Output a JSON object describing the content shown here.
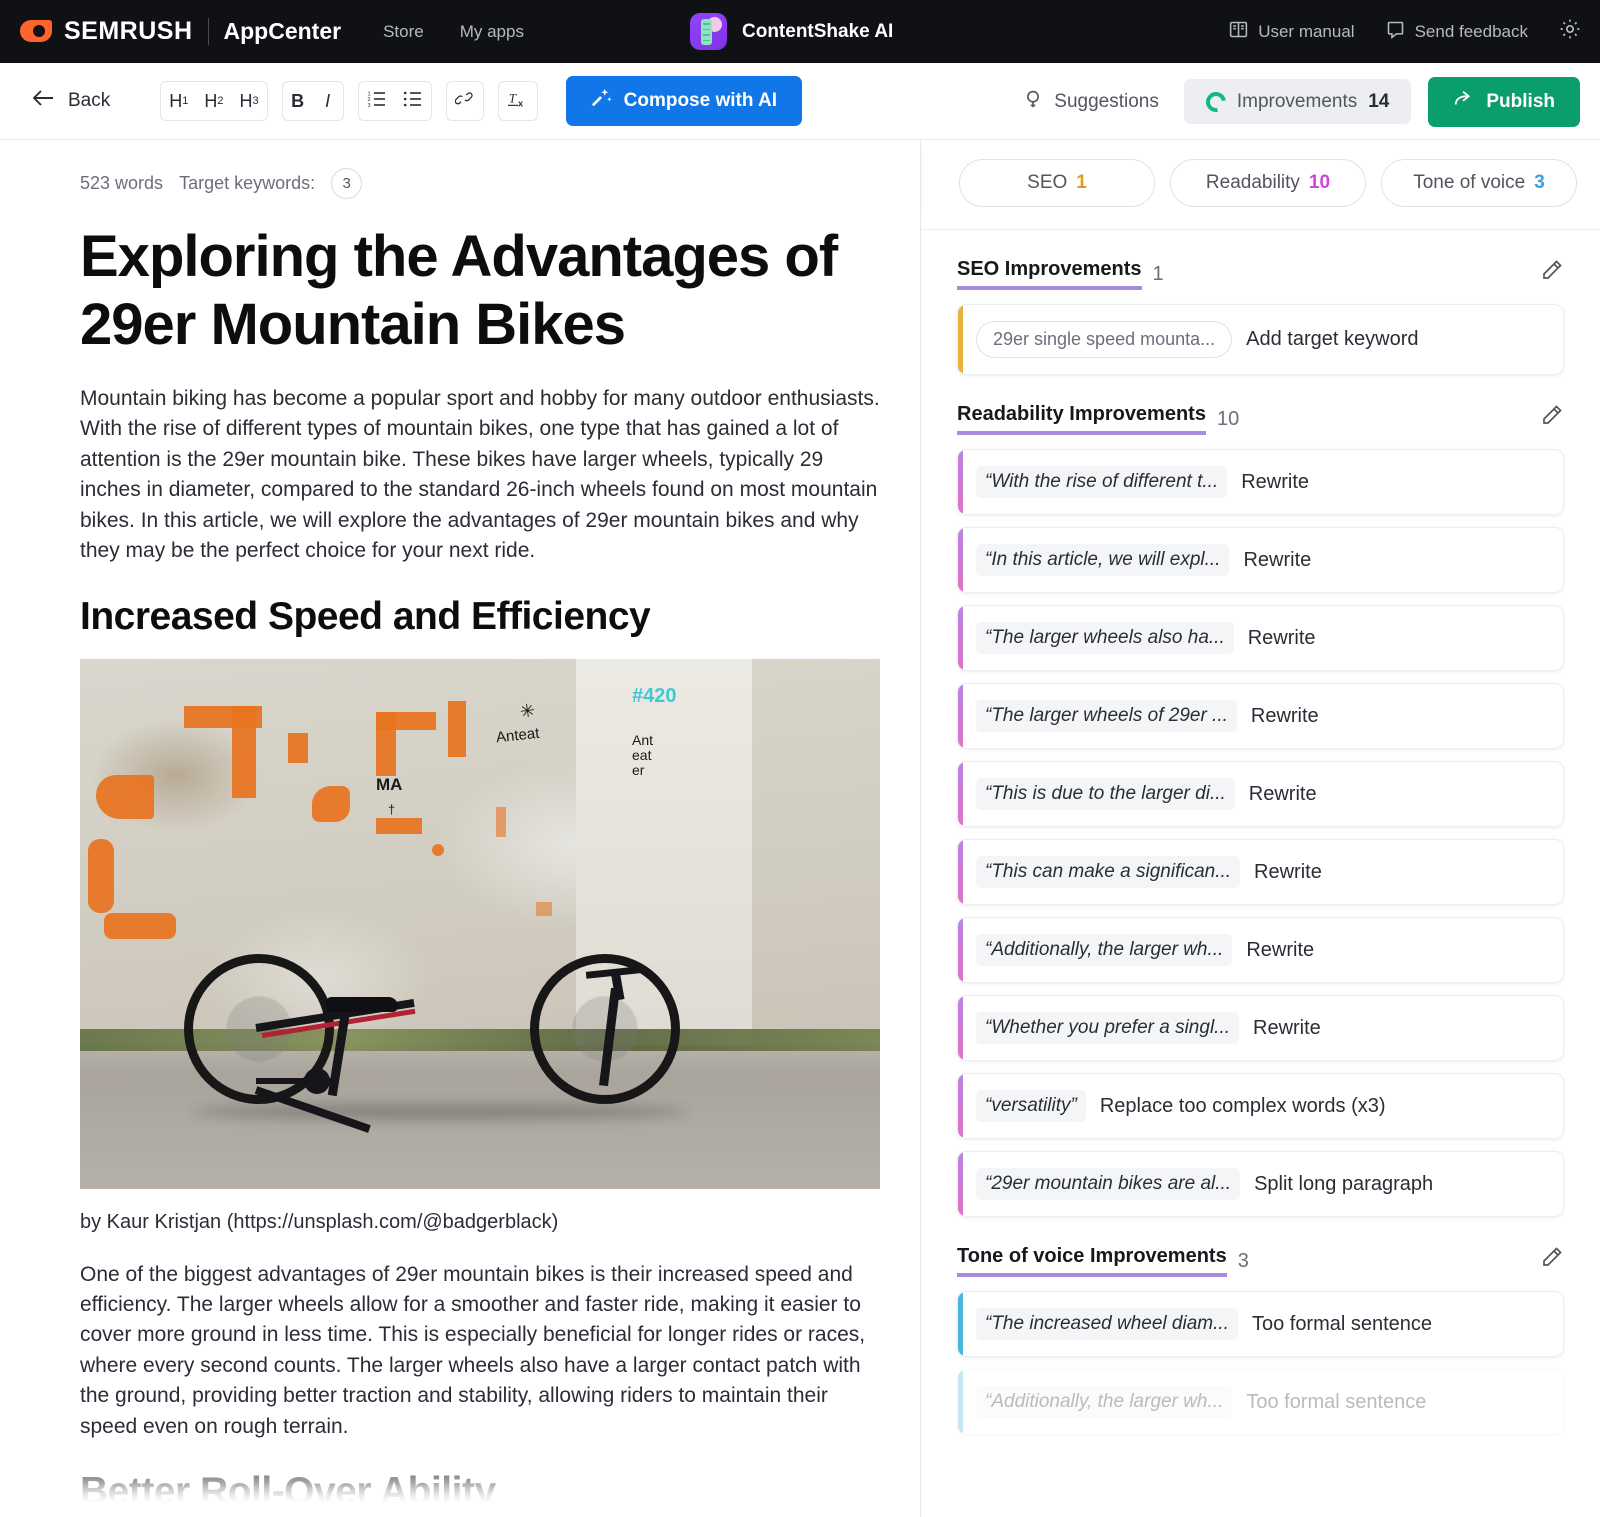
{
  "topbar": {
    "brand": "SEMRUSH",
    "brand_sub": "AppCenter",
    "nav": [
      {
        "label": "Store"
      },
      {
        "label": "My apps"
      }
    ],
    "app_title": "ContentShake AI",
    "right_items": [
      {
        "label": "User manual",
        "icon": "book-icon"
      },
      {
        "label": "Send feedback",
        "icon": "speech-bubble-icon"
      }
    ],
    "settings_icon": "gear-icon"
  },
  "toolbar": {
    "back_label": "Back",
    "format_groups": [
      {
        "buttons": [
          {
            "label": "H1"
          },
          {
            "label": "H2"
          },
          {
            "label": "H3"
          }
        ]
      },
      {
        "buttons": [
          {
            "label": "B"
          },
          {
            "label": "I"
          }
        ]
      },
      {
        "buttons": [
          {
            "label": "ordered-list-icon"
          },
          {
            "label": "bulleted-list-icon"
          }
        ]
      },
      {
        "buttons": [
          {
            "label": "link-icon"
          }
        ]
      },
      {
        "buttons": [
          {
            "label": "clear-formatting-icon"
          }
        ]
      }
    ],
    "compose_label": "Compose with AI",
    "suggestions_label": "Suggestions",
    "improvements_label": "Improvements",
    "improvements_count": "14",
    "publish_label": "Publish"
  },
  "editor": {
    "word_count": "523 words",
    "target_keywords_label": "Target keywords:",
    "target_keywords_count": "3",
    "title": "Exploring the Advantages of 29er Mountain Bikes",
    "paragraph_1": "Mountain biking has become a popular sport and hobby for many outdoor enthusiasts. With the rise of different types of mountain bikes, one type that has gained a lot of attention is the 29er mountain bike. These bikes have larger wheels, typically 29 inches in diameter, compared to the standard 26-inch wheels found on most mountain bikes. In this article, we will explore the advantages of 29er mountain bikes and why they may be the perfect choice for your next ride.",
    "heading_2": "Increased Speed and Efficiency",
    "image_alt": "mountain-bike-against-graffiti-wall-photo",
    "image_caption": "by Kaur Kristjan (https://unsplash.com/@badgerblack)",
    "paragraph_2": "One of the biggest advantages of 29er mountain bikes is their increased speed and efficiency. The larger wheels allow for a smoother and faster ride, making it easier to cover more ground in less time. This is especially beneficial for longer rides or races, where every second counts. The larger wheels also have a larger contact patch with the ground, providing better traction and stability, allowing riders to maintain their speed even on rough terrain.",
    "heading_3": "Better Roll-Over Ability"
  },
  "panel": {
    "collapse_icon": "chevron-double-right-icon",
    "tabs": [
      {
        "label": "SEO",
        "count": "1"
      },
      {
        "label": "Readability",
        "count": "10"
      },
      {
        "label": "Tone of voice",
        "count": "3"
      }
    ],
    "sections": [
      {
        "title": "SEO Improvements",
        "count": "1",
        "edit_icon": "pencil-icon",
        "kind": "seo",
        "items": [
          {
            "snippet": "29er single speed mounta...",
            "action": "Add target keyword",
            "snippet_style": "pill"
          }
        ]
      },
      {
        "title": "Readability Improvements",
        "count": "10",
        "edit_icon": "pencil-icon",
        "kind": "read",
        "items": [
          {
            "snippet": "“With the rise of different t...",
            "action": "Rewrite"
          },
          {
            "snippet": "“In this article, we will expl...",
            "action": "Rewrite"
          },
          {
            "snippet": "“The larger wheels also ha...",
            "action": "Rewrite"
          },
          {
            "snippet": "“The larger wheels of 29er ...",
            "action": "Rewrite"
          },
          {
            "snippet": "“This is due to the larger di...",
            "action": "Rewrite"
          },
          {
            "snippet": "“This can make a significan...",
            "action": "Rewrite"
          },
          {
            "snippet": "“Additionally, the larger wh...",
            "action": "Rewrite"
          },
          {
            "snippet": "“Whether you prefer a singl...",
            "action": "Rewrite"
          },
          {
            "snippet": "“versatility”",
            "action": "Replace too complex words  (x3)"
          },
          {
            "snippet": "“29er mountain bikes are al...",
            "action": "Split long paragraph"
          }
        ]
      },
      {
        "title": "Tone of voice Improvements",
        "count": "3",
        "edit_icon": "pencil-icon",
        "kind": "tone",
        "items": [
          {
            "snippet": "“The increased wheel diam...",
            "action": "Too formal sentence"
          },
          {
            "snippet": "“Additionally, the larger wh...",
            "action": "Too formal sentence",
            "ghost": true
          }
        ]
      }
    ]
  },
  "colors": {
    "topbar_bg": "#101114",
    "accent_blue": "#1176e8",
    "publish_green": "#099e6b",
    "donut_green": "#14b686",
    "seo_amber": "#e29822",
    "readability_magenta": "#cd47d8",
    "tone_blue": "#3b9fe0",
    "section_underline": "#a98cde"
  }
}
